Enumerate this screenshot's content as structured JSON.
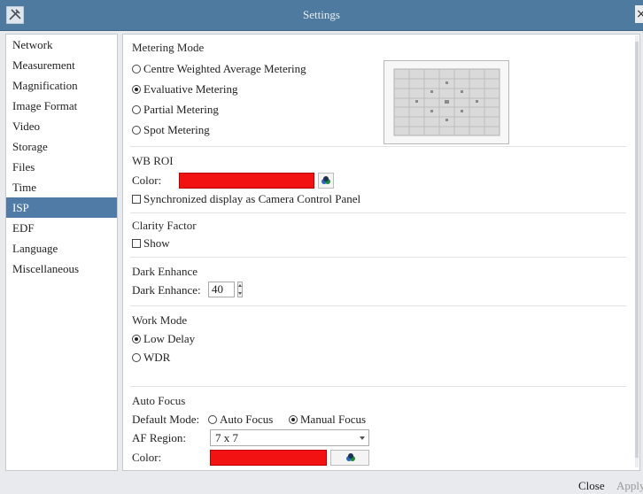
{
  "window": {
    "title": "Settings",
    "close_glyph": "×",
    "app_icon": "tools-icon"
  },
  "sidebar": {
    "items": [
      {
        "label": "Network"
      },
      {
        "label": "Measurement"
      },
      {
        "label": "Magnification"
      },
      {
        "label": "Image Format"
      },
      {
        "label": "Video"
      },
      {
        "label": "Storage"
      },
      {
        "label": "Files"
      },
      {
        "label": "Time"
      },
      {
        "label": "ISP",
        "active": true
      },
      {
        "label": "EDF"
      },
      {
        "label": "Language"
      },
      {
        "label": "Miscellaneous"
      }
    ]
  },
  "metering": {
    "title": "Metering Mode",
    "options": [
      {
        "label": "Centre Weighted Average Metering",
        "selected": false
      },
      {
        "label": "Evaluative Metering",
        "selected": true
      },
      {
        "label": "Partial Metering",
        "selected": false
      },
      {
        "label": "Spot Metering",
        "selected": false
      }
    ]
  },
  "wb_roi": {
    "title": "WB ROI",
    "color_label": "Color:",
    "color": "#f21212",
    "sync_label": "Synchronized display as Camera Control Panel",
    "sync_checked": false
  },
  "clarity": {
    "title": "Clarity Factor",
    "show_label": "Show",
    "show_checked": false
  },
  "dark_enhance": {
    "title": "Dark Enhance",
    "label": "Dark Enhance:",
    "value": "40"
  },
  "work_mode": {
    "title": "Work Mode",
    "options": [
      {
        "label": "Low Delay",
        "selected": true
      },
      {
        "label": "WDR",
        "selected": false
      }
    ]
  },
  "auto_focus": {
    "title": "Auto Focus",
    "default_mode_label": "Default Mode:",
    "modes": [
      {
        "label": "Auto Focus",
        "selected": false
      },
      {
        "label": "Manual Focus",
        "selected": true
      }
    ],
    "af_region_label": "AF Region:",
    "af_region_value": "7 x 7",
    "color_label": "Color:",
    "color": "#f21212"
  },
  "footer": {
    "close_label": "Close",
    "apply_label": "Apply"
  },
  "colors": {
    "titlebar": "#4e7a9f",
    "selection": "#4f7ba6",
    "swatch": "#f21212"
  }
}
